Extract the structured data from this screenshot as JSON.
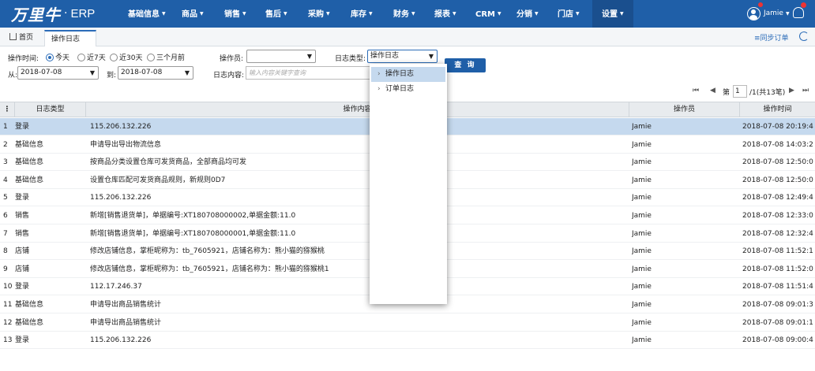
{
  "brand": {
    "logo": "万里牛",
    "dot": "·",
    "product": "ERP"
  },
  "nav": [
    {
      "label": "基础信息",
      "caret": "▼"
    },
    {
      "label": "商品",
      "caret": "▼"
    },
    {
      "label": "销售",
      "caret": "▼"
    },
    {
      "label": "售后",
      "caret": "▼"
    },
    {
      "label": "采购",
      "caret": "▼"
    },
    {
      "label": "库存",
      "caret": "▼"
    },
    {
      "label": "财务",
      "caret": "▼"
    },
    {
      "label": "报表",
      "caret": "▼"
    },
    {
      "label": "CRM",
      "caret": "▼"
    },
    {
      "label": "分销",
      "caret": "▼"
    },
    {
      "label": "门店",
      "caret": "▼"
    },
    {
      "label": "设置",
      "caret": "▼"
    }
  ],
  "user": {
    "name": "Jamie",
    "caret": "▼"
  },
  "tabs": {
    "home": "首页",
    "current": "操作日志",
    "close": "×"
  },
  "toolbar": {
    "sync": "≡同步订单"
  },
  "filters": {
    "time_label": "操作时间:",
    "radios": [
      "今天",
      "近7天",
      "近30天",
      "三个月前"
    ],
    "from_label": "从:",
    "from_value": "2018-07-08",
    "to_label": "到:",
    "to_value": "2018-07-08",
    "operator_label": "操作员:",
    "operator_value": "",
    "type_label": "日志类型:",
    "type_value": "操作日志",
    "content_label": "日志内容:",
    "content_placeholder": "输入内容关键字查询",
    "query_button": "查 询",
    "arrow": "▼"
  },
  "dropdown": {
    "chevron": "›",
    "options": [
      "操作日志",
      "订单日志"
    ]
  },
  "pager": {
    "first": "⏮",
    "prev": "◀",
    "page_label": "第",
    "page": "1",
    "total": "/1(共13笔)",
    "next": "▶",
    "last": "⏭"
  },
  "table": {
    "menu": "⋮",
    "columns": {
      "type": "日志类型",
      "content": "操作内容",
      "operator": "操作员",
      "time": "操作时间"
    },
    "rows": [
      {
        "idx": "1",
        "type": "登录",
        "content": "115.206.132.226",
        "operator": "Jamie",
        "time": "2018-07-08 20:19:44"
      },
      {
        "idx": "2",
        "type": "基础信息",
        "content": "申请导出导出物流信息",
        "operator": "Jamie",
        "time": "2018-07-08 14:03:25"
      },
      {
        "idx": "3",
        "type": "基础信息",
        "content": "按商品分类设置仓库可发货商品，全部商品均可发",
        "operator": "Jamie",
        "time": "2018-07-08 12:50:09"
      },
      {
        "idx": "4",
        "type": "基础信息",
        "content": "设置仓库匹配可发货商品规则，新规则0D7",
        "operator": "Jamie",
        "time": "2018-07-08 12:50:09"
      },
      {
        "idx": "5",
        "type": "登录",
        "content": "115.206.132.226",
        "operator": "Jamie",
        "time": "2018-07-08 12:49:49"
      },
      {
        "idx": "6",
        "type": "销售",
        "content": "新增[销售退货单]，单据编号:XT180708000002,单据金额:11.0",
        "operator": "Jamie",
        "time": "2018-07-08 12:33:05"
      },
      {
        "idx": "7",
        "type": "销售",
        "content": "新增[销售退货单]，单据编号:XT180708000001,单据金额:11.0",
        "operator": "Jamie",
        "time": "2018-07-08 12:32:42"
      },
      {
        "idx": "8",
        "type": "店铺",
        "content": "修改店铺信息，掌柜昵称为：tb_7605921，店铺名称为：熊小猫的猕猴桃",
        "operator": "Jamie",
        "time": "2018-07-08 11:52:11"
      },
      {
        "idx": "9",
        "type": "店铺",
        "content": "修改店铺信息，掌柜昵称为：tb_7605921，店铺名称为：熊小猫的猕猴桃1",
        "operator": "Jamie",
        "time": "2018-07-08 11:52:04"
      },
      {
        "idx": "10",
        "type": "登录",
        "content": "112.17.246.37",
        "operator": "Jamie",
        "time": "2018-07-08 11:51:49"
      },
      {
        "idx": "11",
        "type": "基础信息",
        "content": "申请导出商品销售统计",
        "operator": "Jamie",
        "time": "2018-07-08 09:01:37"
      },
      {
        "idx": "12",
        "type": "基础信息",
        "content": "申请导出商品销售统计",
        "operator": "Jamie",
        "time": "2018-07-08 09:01:17"
      },
      {
        "idx": "13",
        "type": "登录",
        "content": "115.206.132.226",
        "operator": "Jamie",
        "time": "2018-07-08 09:00:48"
      }
    ]
  }
}
